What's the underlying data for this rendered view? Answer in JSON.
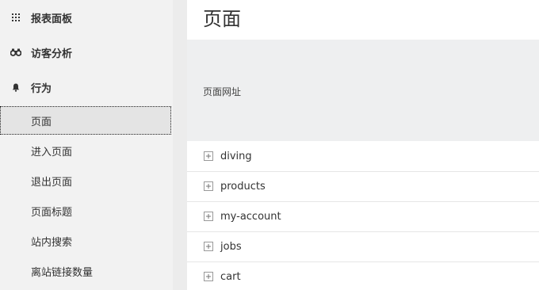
{
  "sidebar": {
    "sections": [
      {
        "label": "报表面板",
        "icon": "grid-icon"
      },
      {
        "label": "访客分析",
        "icon": "binoculars-icon"
      },
      {
        "label": "行为",
        "icon": "bell-icon"
      }
    ],
    "behavior_items": [
      {
        "label": "页面",
        "active": true
      },
      {
        "label": "进入页面",
        "active": false
      },
      {
        "label": "退出页面",
        "active": false
      },
      {
        "label": "页面标题",
        "active": false
      },
      {
        "label": "站内搜索",
        "active": false
      },
      {
        "label": "离站链接数量",
        "active": false
      }
    ]
  },
  "main": {
    "title": "页面",
    "table": {
      "column_header": "页面网址",
      "rows": [
        {
          "label": "diving"
        },
        {
          "label": "products"
        },
        {
          "label": "my-account"
        },
        {
          "label": "jobs"
        },
        {
          "label": "cart"
        }
      ]
    }
  },
  "colors": {
    "sidebar_bg": "#f2f2f2",
    "active_item_bg": "#e4e4e4",
    "table_header_bg": "#eeeff0",
    "text": "#333333"
  }
}
